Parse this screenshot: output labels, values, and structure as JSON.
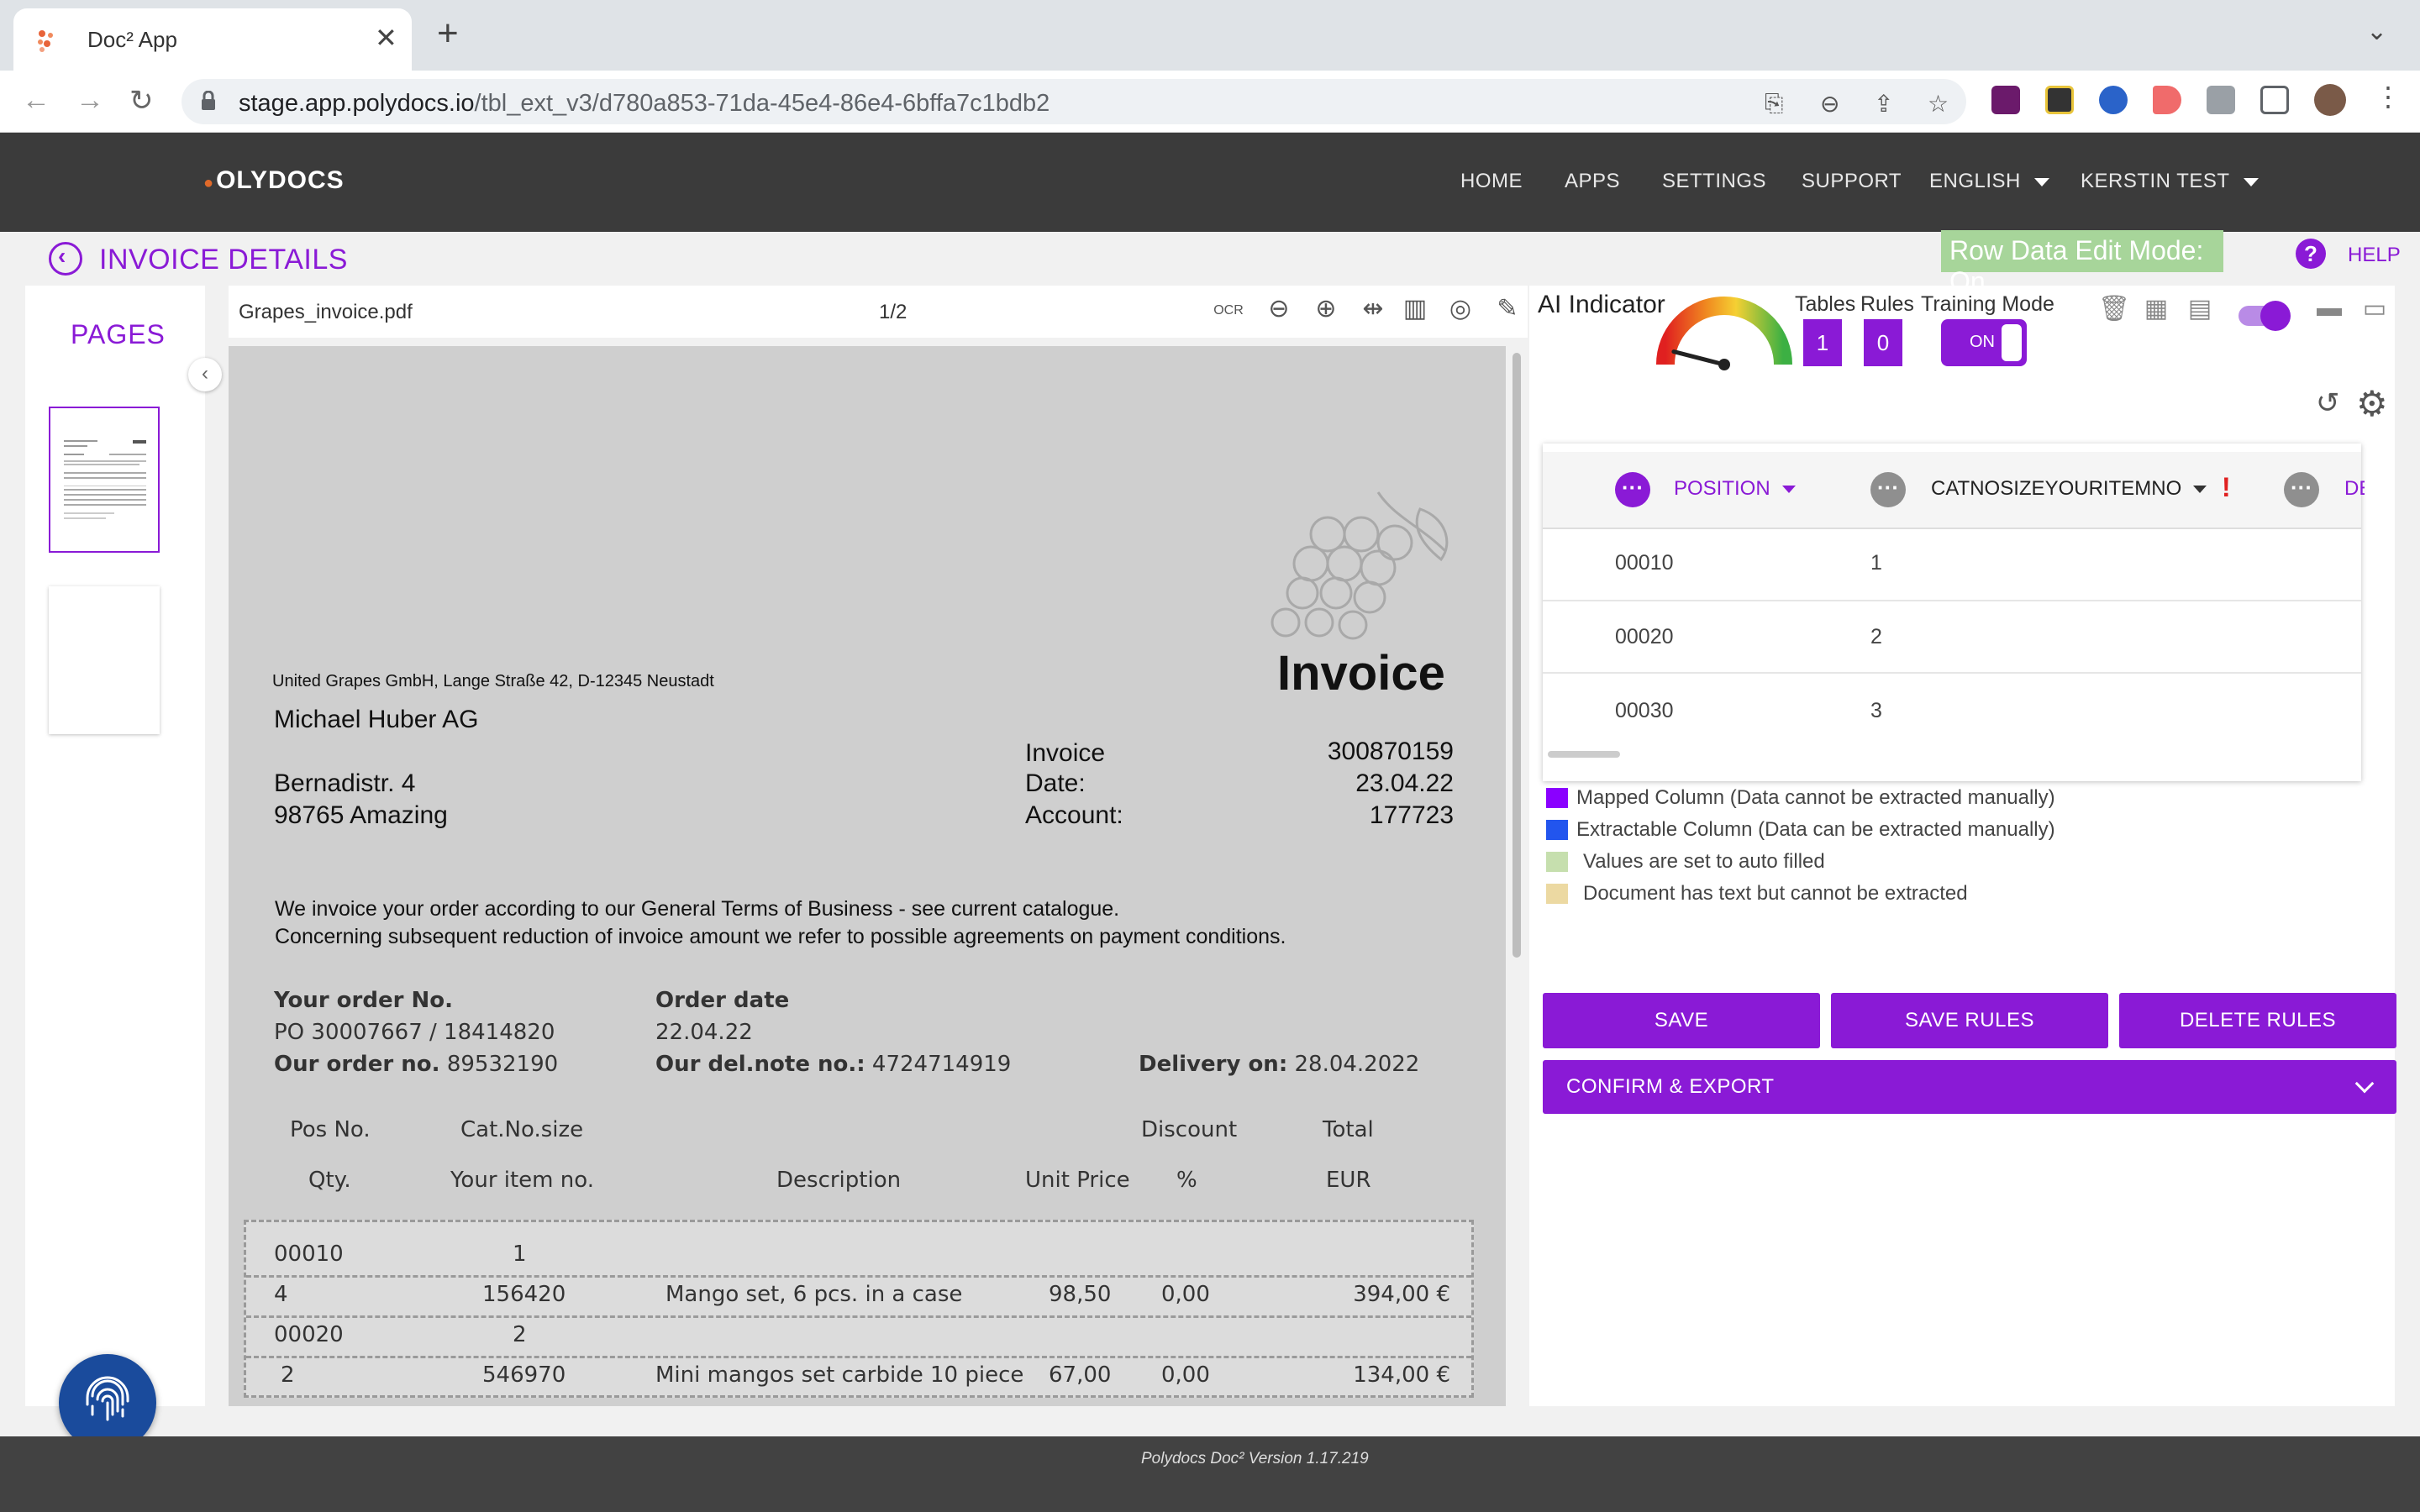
{
  "browser": {
    "tab_title": "Doc² App",
    "url_host": "stage.app.polydocs.io",
    "url_path": "/tbl_ext_v3/d780a853-71da-45e4-86e4-6bffa7c1bdb2"
  },
  "header": {
    "logo": "OLYDOCS",
    "nav": [
      "HOME",
      "APPS",
      "SETTINGS",
      "SUPPORT",
      "ENGLISH",
      "KERSTIN TEST"
    ]
  },
  "page": {
    "title": "INVOICE DETAILS",
    "edit_mode": "Row Data Edit Mode: On",
    "help": "HELP"
  },
  "sidebar": {
    "title": "PAGES"
  },
  "viewer": {
    "filename": "Grapes_invoice.pdf",
    "page_count": "1/2"
  },
  "invoice": {
    "sender": "United Grapes GmbH, Lange Straße 42, D-12345 Neustadt",
    "heading": "Invoice",
    "recipient_name": "Michael Huber AG",
    "recipient_street": "Bernadistr. 4",
    "recipient_city": "98765 Amazing",
    "meta_labels": [
      "Invoice",
      "Date:",
      "Account:"
    ],
    "meta_values": [
      "300870159",
      "23.04.22",
      "177723"
    ],
    "intro_1": "We invoice your order according to our General Terms of Business - see current catalogue.",
    "intro_2": "Concerning subsequent reduction of invoice amount we refer to possible agreements on payment conditions.",
    "your_order_label": "Your order No.",
    "your_order_value": "PO 30007667 / 18414820",
    "our_order_label": "Our order no.",
    "our_order_value": "89532190",
    "order_date_label": "Order date",
    "order_date_value": "22.04.22",
    "del_note_label": "Our del.note no.:",
    "del_note_value": "4724714919",
    "delivery_label": "Delivery on:",
    "delivery_value": "28.04.2022",
    "col_row1": [
      "Pos No.",
      "Cat.No.size",
      "Discount",
      "Total"
    ],
    "col_row2": [
      "Qty.",
      "Your item no.",
      "Description",
      "Unit Price",
      "%",
      "EUR"
    ],
    "lines": [
      {
        "pos": "00010",
        "cat": "1",
        "qty": "4",
        "item": "156420",
        "desc": "Mango set, 6 pcs. in a case",
        "price": "98,50",
        "disc": "0,00",
        "total": "394,00 €"
      },
      {
        "pos": "00020",
        "cat": "2",
        "qty": "2",
        "item": "546970",
        "desc": "Mini mangos set carbide 10 piece",
        "price": "67,00",
        "disc": "0,00",
        "total": "134,00 €"
      }
    ]
  },
  "panel": {
    "ai_indicator": "AI Indicator",
    "gauge_level": 0.08,
    "tables_label": "Tables",
    "tables_value": "1",
    "rules_label": "Rules",
    "rules_value": "0",
    "training_label": "Training Mode",
    "training_value": "ON",
    "columns": [
      "POSITION",
      "CATNOSIZEYOURITEMNO",
      "DE"
    ],
    "rows": [
      {
        "position": "00010",
        "catno": "1"
      },
      {
        "position": "00020",
        "catno": "2"
      },
      {
        "position": "00030",
        "catno": "3"
      }
    ],
    "legend": [
      {
        "color": "#8a00ff",
        "text": "Mapped Column (Data cannot be extracted manually)"
      },
      {
        "color": "#2255ee",
        "text": "Extractable Column (Data can be extracted manually)"
      },
      {
        "color": "#c6dfae",
        "text": "Values are set to auto filled"
      },
      {
        "color": "#ecd9a2",
        "text": "Document has text but cannot be extracted"
      }
    ],
    "buttons": [
      "SAVE",
      "SAVE RULES",
      "DELETE RULES"
    ],
    "confirm": "CONFIRM & EXPORT"
  },
  "footer": {
    "version": "Polydocs Doc² Version 1.17.219"
  }
}
